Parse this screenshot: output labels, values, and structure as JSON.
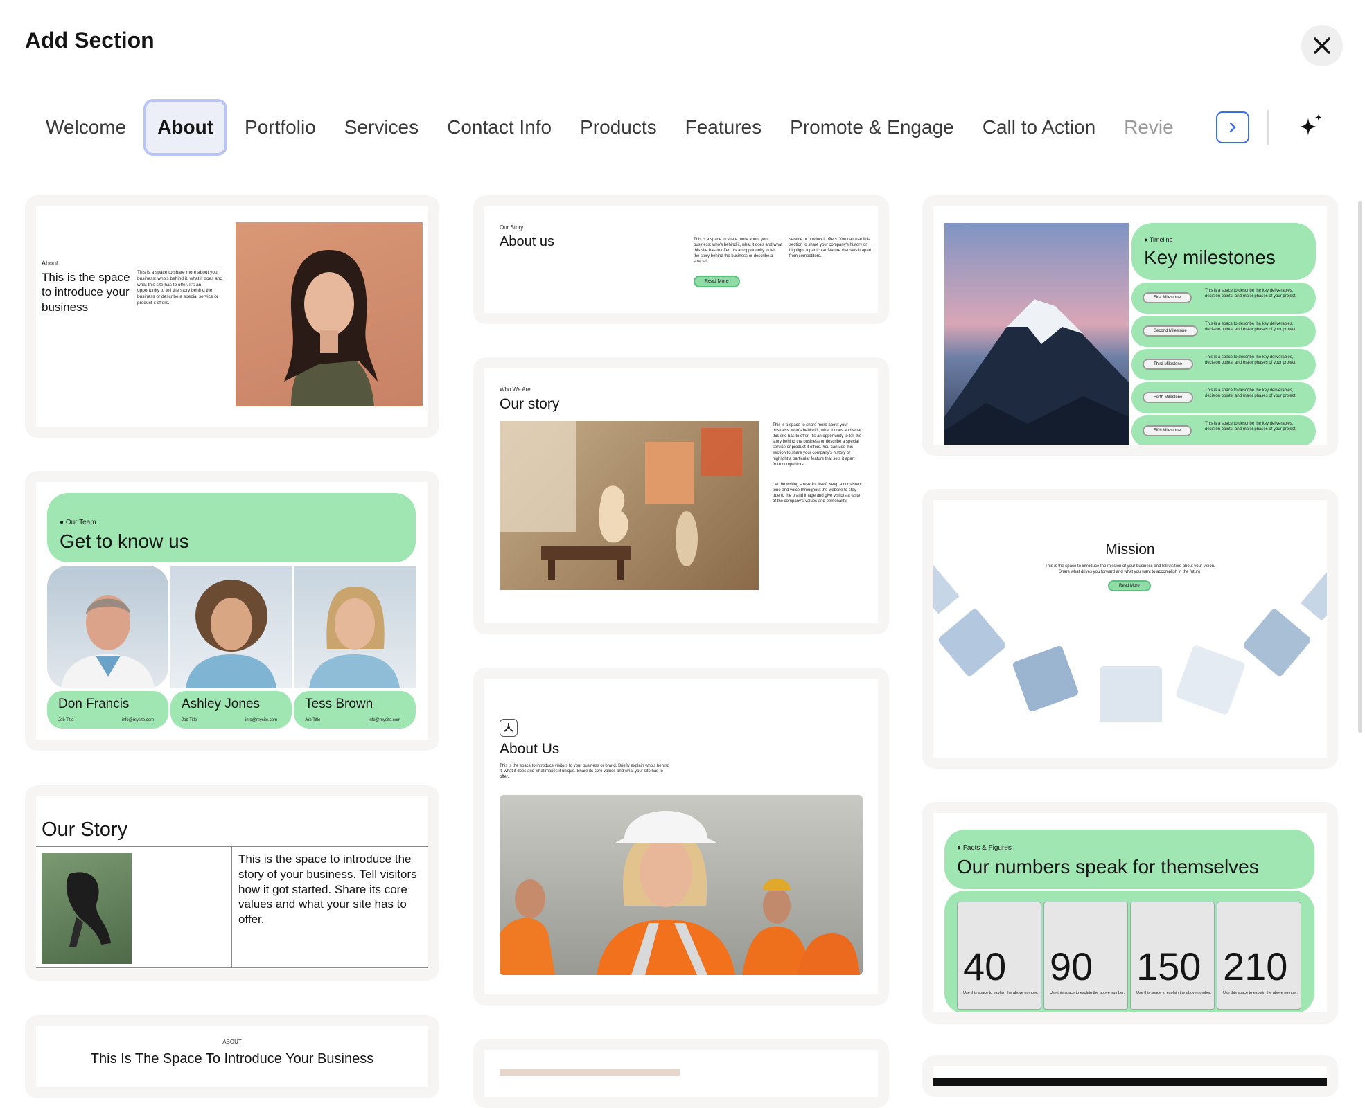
{
  "header": {
    "title": "Add Section"
  },
  "tabs": [
    {
      "label": "Welcome"
    },
    {
      "label": "About"
    },
    {
      "label": "Portfolio"
    },
    {
      "label": "Services"
    },
    {
      "label": "Contact Info"
    },
    {
      "label": "Products"
    },
    {
      "label": "Features"
    },
    {
      "label": "Promote & Engage"
    },
    {
      "label": "Call to Action"
    },
    {
      "label": "Revie"
    }
  ],
  "active_tab": "About",
  "colors": {
    "accent": "#a0e6b3",
    "tab_active_border": "#b9c4f7",
    "next_button": "#3b6cf0"
  },
  "icons": {
    "close": "close-icon",
    "next": "chevron-right-icon",
    "ai": "sparkle-icon"
  },
  "cards": {
    "c1": {
      "kicker": "About",
      "title": "This is the space to introduce your business",
      "body": "This is a space to share more about your business: who's behind it, what it does and what this site has to offer. It's an opportunity to tell the story behind the business or describe a special service or product it offers."
    },
    "c2": {
      "kicker": "Our Team",
      "title": "Get to know us",
      "members": [
        {
          "name": "Don Francis",
          "role": "Job Title",
          "email": "info@mysite.com"
        },
        {
          "name": "Ashley Jones",
          "role": "Job Title",
          "email": "info@mysite.com"
        },
        {
          "name": "Tess Brown",
          "role": "Job Title",
          "email": "info@mysite.com"
        }
      ]
    },
    "c3": {
      "title": "Our Story",
      "body": "This is the space to introduce the story of your business. Tell visitors how it got started. Share its core values and what your site has to offer."
    },
    "c4": {
      "kicker": "ABOUT",
      "title": "This Is The Space To Introduce Your Business"
    },
    "c5": {
      "kicker": "Our Story",
      "title": "About us",
      "body1": "This is a space to share more about your business: who's behind it, what it does and what this site has to offer. It's an opportunity to tell the story behind the business or describe a special",
      "body2": "service or product it offers. You can use this section to share your company's history or highlight a particular feature that sets it apart from competitors.",
      "button": "Read More"
    },
    "c6": {
      "kicker": "Who We Are",
      "title": "Our story",
      "body1": "This is a space to share more about your business: who's behind it, what it does and what this site has to offer. It's an opportunity to tell the story behind the business or describe a special service or product it offers. You can use this section to share your company's history or highlight a particular feature that sets it apart from competitors.",
      "body2": "Let the writing speak for itself. Keep a consistent tone and voice throughout the website to stay true to the brand image and give visitors a taste of the company's values and personality."
    },
    "c7": {
      "title": "About Us",
      "body": "This is the space to introduce visitors to your business or brand. Briefly explain who's behind it, what it does and what makes it unique. Share its core values and what your site has to offer."
    },
    "c8": {
      "kicker": "Timeline",
      "title": "Key milestones",
      "milestones": [
        {
          "label": "First Milestone",
          "text": "This is a space to describe the key deliverables, decision points, and major phases of your project."
        },
        {
          "label": "Second Milestone",
          "text": "This is a space to describe the key deliverables, decision points, and major phases of your project."
        },
        {
          "label": "Third Milestone",
          "text": "This is a space to describe the key deliverables, decision points, and major phases of your project."
        },
        {
          "label": "Forth Milestone",
          "text": "This is a space to describe the key deliverables, decision points, and major phases of your project."
        },
        {
          "label": "Fifth Milestone",
          "text": "This is a space to describe the key deliverables, decision points, and major phases of your project."
        }
      ]
    },
    "c9": {
      "title": "Mission",
      "body": "This is the space to introduce the mission of your business and tell visitors about your vision. Share what drives you forward and what you want to accomplish in the future.",
      "button": "Read More"
    },
    "c10": {
      "kicker": "Facts & Figures",
      "title": "Our numbers speak for themselves",
      "stats": [
        {
          "value": "40",
          "caption": "Use this space to explain the above number."
        },
        {
          "value": "90",
          "caption": "Use this space to explain the above number."
        },
        {
          "value": "150",
          "caption": "Use this space to explain the above number."
        },
        {
          "value": "210",
          "caption": "Use this space to explain the above number."
        }
      ]
    }
  }
}
